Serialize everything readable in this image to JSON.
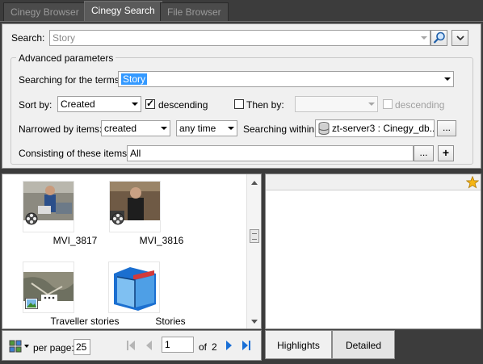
{
  "tabs": [
    {
      "label": "Cinegy Browser"
    },
    {
      "label": "Cinegy Search"
    },
    {
      "label": "File Browser"
    }
  ],
  "search": {
    "label": "Search:",
    "value": "Story"
  },
  "advanced": {
    "title": "Advanced parameters",
    "terms_label": "Searching for the terms:",
    "terms_value": "Story",
    "sort_label": "Sort by:",
    "sort_value": "Created",
    "descending_label": "descending",
    "descending_checked": true,
    "then_label": "Then by:",
    "then_value": "",
    "then_descending_label": "descending",
    "narrowed_label": "Narrowed by items:",
    "narrowed_value": "created",
    "time_value": "any time",
    "within_label": "Searching within:",
    "within_value": "zt-server3 : Cinegy_db...",
    "browse_label": "...",
    "consisting_label": "Consisting of these items:",
    "consisting_value": "All",
    "consisting_browse_label": "...",
    "add_label": "+"
  },
  "results": [
    {
      "label": "MVI_3817",
      "type": "video"
    },
    {
      "label": "MVI_3816",
      "type": "video"
    },
    {
      "label": "Traveller stories",
      "type": "image"
    },
    {
      "label": "Stories",
      "type": "folder"
    }
  ],
  "pager": {
    "per_page_label": "per page:",
    "per_page_value": "25",
    "page_value": "1",
    "of_label": "of",
    "total_pages": "2"
  },
  "preview_tabs": [
    {
      "label": "Highlights"
    },
    {
      "label": "Detailed"
    }
  ],
  "colors": {
    "background": "#3c3c3c",
    "selection": "#3399ff",
    "nav_blue": "#1a6fd6"
  }
}
